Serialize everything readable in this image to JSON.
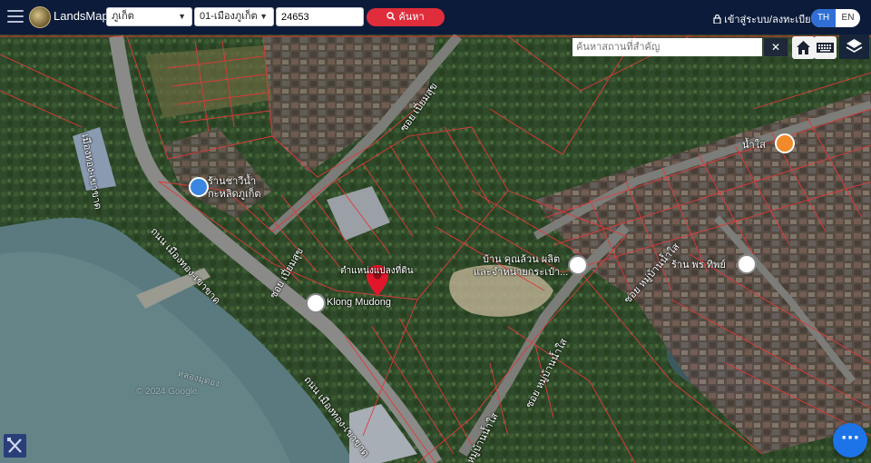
{
  "header": {
    "brand": "LandsMaps",
    "province": "ภูเก็ต",
    "district": "01-เมืองภูเก็ต",
    "parcel_number": "24653",
    "search_label": "ค้นหา",
    "login_label": "เข้าสู่ระบบ/ลงทะเบียน",
    "lang_th": "TH",
    "lang_en": "EN"
  },
  "map": {
    "place_search_placeholder": "ค้นหาสถานที่สำคัญ",
    "pin_label": "ตำแหน่งแปลงที่ดิน",
    "labels": {
      "shop_1": "ร้านชาวีน้ำ",
      "shop_2": "กะหลิดภูเก็ต",
      "klong_mudong": "Klong Mudong",
      "house_1": "บ้าน คุณล้วน ผลิต",
      "house_2": "และจำหน่ายกระเป๋า...",
      "shop_right": "ร้าน พร ทิพย์",
      "nam_sai": "น้ำใส",
      "watermark_1": "หลองมุดอง",
      "watermark_2": "© 2024 Google"
    },
    "roads": {
      "left_vertical": "เมืองทอง-เขาขาด",
      "soi_piam_suk_top": "ซอย เปี่ยมสุข",
      "soi_piam_suk_mid": "ซอย เปี่ยมสุข",
      "road_main_1": "ถนน เมืองทอง-เขาขาด",
      "road_main_2": "ถนน เมืองทอง-เขาขาด",
      "soi_nam_sai_1": "ซอย หมู่บ้านน้ำใส",
      "soi_nam_sai_2": "ซอย หมู่บ้านน้ำใส",
      "soi_nam_sai_3": "ซอย หมู่บ้านน้ำใส"
    },
    "icons": {
      "menu": "hamburger-icon",
      "search": "search-icon",
      "lock": "lock-icon",
      "home": "home-icon",
      "keyboard": "keyboard-icon",
      "layers": "layers-icon",
      "tools": "tools-icon",
      "chat": "chat-icon"
    },
    "colors": {
      "header_bg": "#0c1b3a",
      "search_btn": "#e02d3c",
      "parcel_lines": "#e03a3a",
      "pin": "#e2162b",
      "lang_active": "#2f6fd6",
      "chat": "#1c74e8"
    }
  }
}
